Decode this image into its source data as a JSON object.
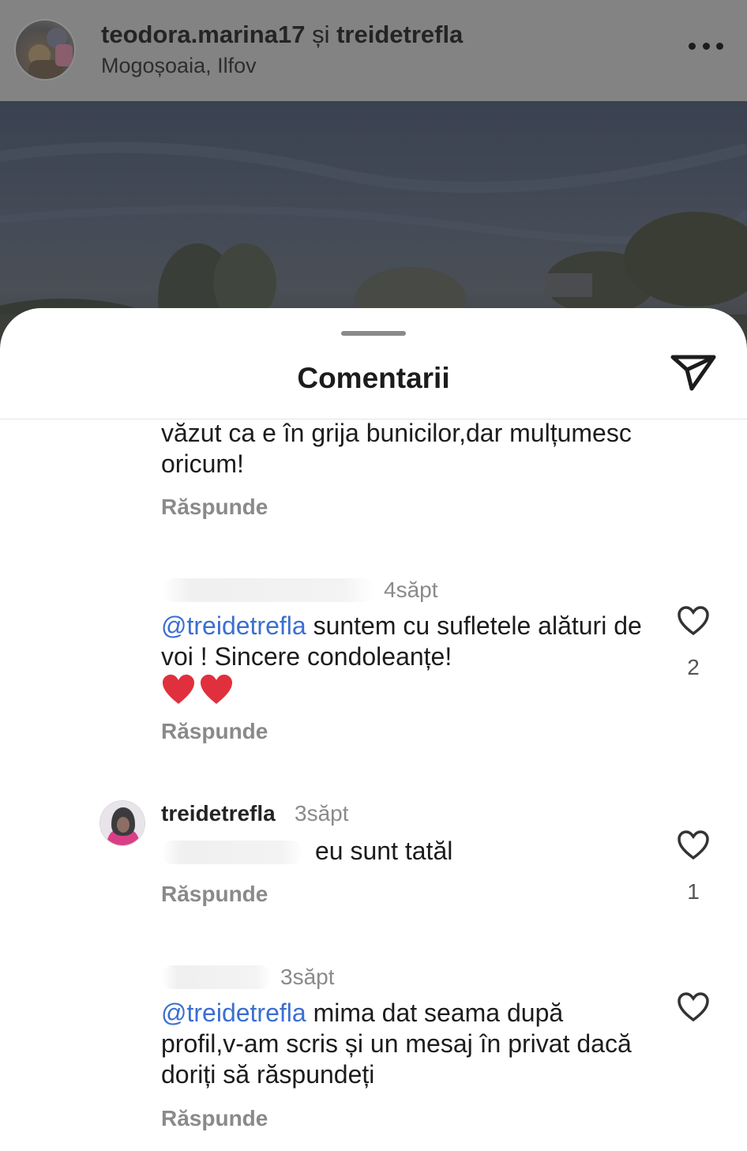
{
  "post": {
    "user_primary": "teodora.marina17",
    "user_connector": "și",
    "user_secondary": "treidetrefla",
    "location": "Mogoșoaia, Ilfov"
  },
  "sheet": {
    "title": "Comentarii"
  },
  "comments": [
    {
      "text": "văzut ca e în grija bunicilor,dar mulțumesc oricum!",
      "reply_label": "Răspunde"
    },
    {
      "time": "4săpt",
      "mention": "@treidetrefla",
      "text": " suntem cu sufletele alături de voi ! Sincere condoleanțe!",
      "emoji": "❤️❤️",
      "likes": "2",
      "reply_label": "Răspunde"
    },
    {
      "username": "treidetrefla",
      "time": "3săpt",
      "text": "eu sunt tatăl",
      "likes": "1",
      "reply_label": "Răspunde"
    },
    {
      "time": "3săpt",
      "mention": "@treidetrefla",
      "text": " mima dat seama după profil,v-am scris și un mesaj în privat dacă doriți să răspundeți",
      "reply_label": "Răspunde"
    }
  ],
  "colors": {
    "mention": "#3b6fd0",
    "secondary_text": "#8a8a8a",
    "heart_emoji": "#e0303d"
  },
  "icons": {
    "share": "paper-plane-icon",
    "like": "heart-outline-icon",
    "more": "more-horizontal-icon"
  }
}
